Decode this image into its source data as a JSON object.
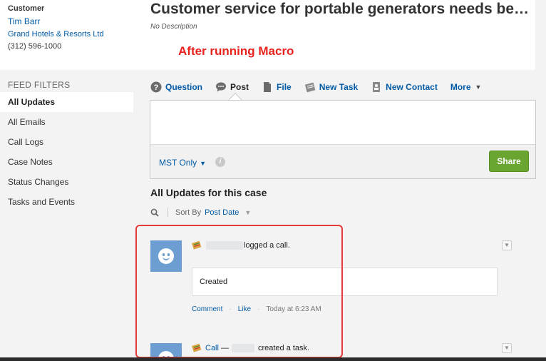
{
  "customer": {
    "label": "Customer",
    "name": "Tim Barr",
    "company": "Grand Hotels & Resorts Ltd",
    "phone": "(312) 596-1000"
  },
  "feed_filters": {
    "heading": "FEED FILTERS",
    "items": [
      {
        "label": "All Updates",
        "active": true
      },
      {
        "label": "All Emails",
        "active": false
      },
      {
        "label": "Call Logs",
        "active": false
      },
      {
        "label": "Case Notes",
        "active": false
      },
      {
        "label": "Status Changes",
        "active": false
      },
      {
        "label": "Tasks and Events",
        "active": false
      }
    ]
  },
  "case": {
    "title": "Customer service for portable generators needs be…",
    "description": "No Description"
  },
  "annotation": "After running Macro",
  "publisher": {
    "tabs": [
      {
        "label": "Question",
        "icon": "question-icon"
      },
      {
        "label": "Post",
        "icon": "speech-bubble-icon"
      },
      {
        "label": "File",
        "icon": "document-icon"
      },
      {
        "label": "New Task",
        "icon": "task-icon"
      },
      {
        "label": "New Contact",
        "icon": "contact-icon"
      },
      {
        "label": "More",
        "icon": "chevron-down-icon"
      }
    ],
    "visibility": "MST Only",
    "share_label": "Share"
  },
  "updates": {
    "title": "All Updates for this case",
    "sort_by_label": "Sort By",
    "sort_value": "Post Date"
  },
  "feed_items": [
    {
      "text": "logged a call.",
      "body": "Created",
      "actions": [
        "Comment",
        "Like"
      ],
      "time": "Today at 6:23 AM"
    },
    {
      "link": "Call",
      "dash": "—",
      "text": "created a task."
    }
  ],
  "colors": {
    "link": "#015ba7",
    "share_button": "#6aa531",
    "annotation": "#e8231e",
    "avatar": "#6c9ed1"
  }
}
